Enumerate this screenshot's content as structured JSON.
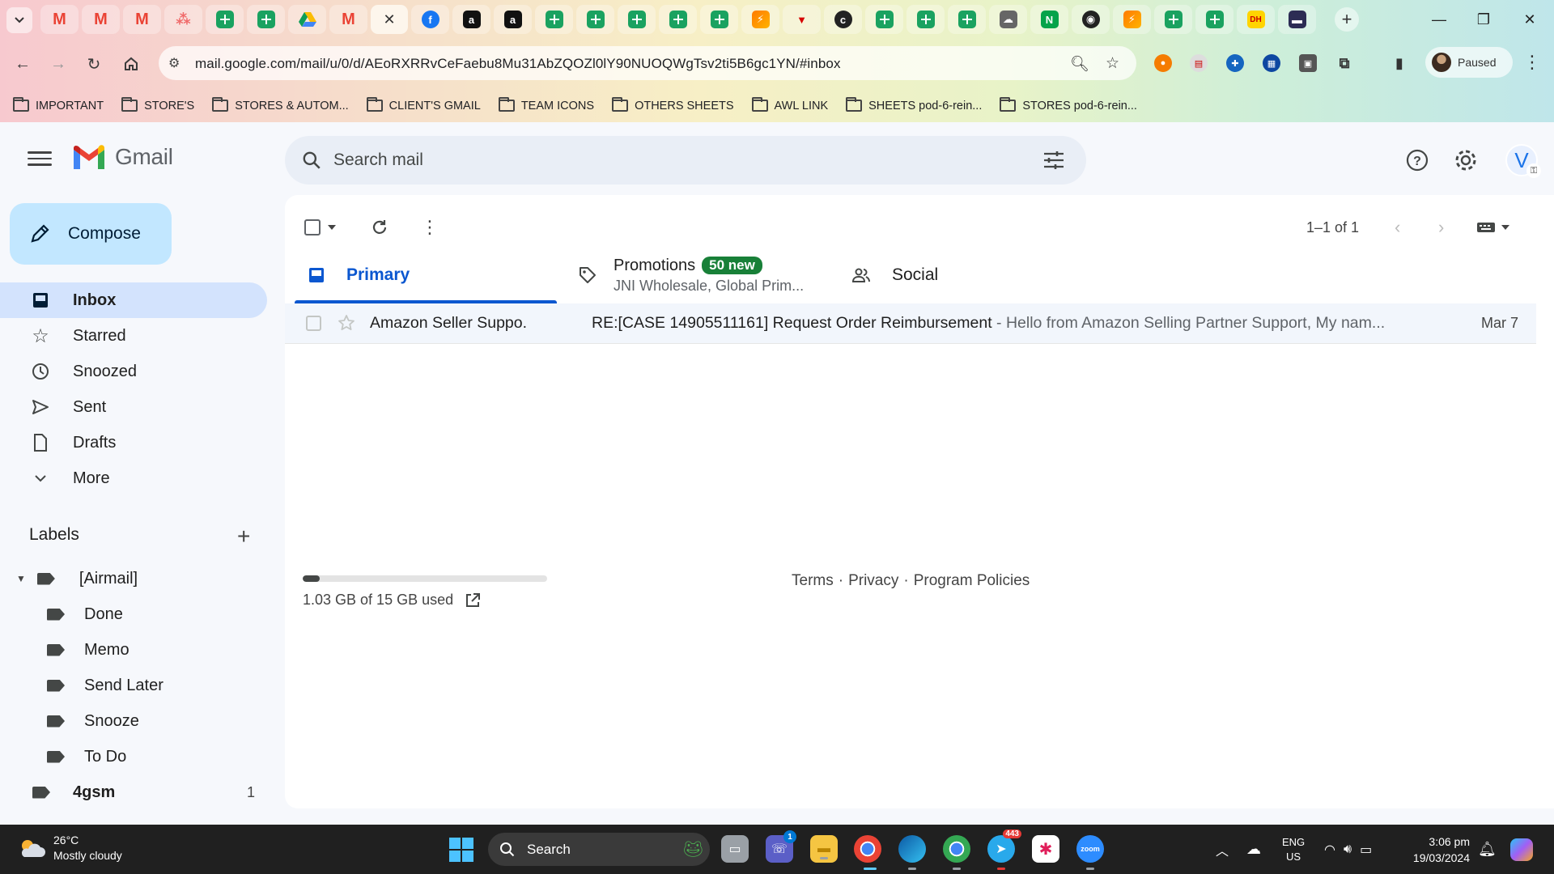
{
  "browser": {
    "url": "mail.google.com/mail/u/0/d/AEoRXRRvCeFaebu8Mu31AbZQOZl0lY90NUOQWgTsv2ti5B6gc1YN/#inbox",
    "profile_status": "Paused",
    "bookmarks": [
      "IMPORTANT",
      "STORE'S",
      "STORES & AUTOM...",
      "CLIENT'S GMAIL",
      "TEAM ICONS",
      "OTHERS SHEETS",
      "AWL LINK",
      "SHEETS pod-6-rein...",
      "STORES pod-6-rein..."
    ]
  },
  "gmail": {
    "app_name": "Gmail",
    "search_placeholder": "Search mail",
    "avatar_letter": "V",
    "compose_label": "Compose",
    "nav": [
      "Inbox",
      "Starred",
      "Snoozed",
      "Sent",
      "Drafts",
      "More"
    ],
    "labels_title": "Labels",
    "labels": [
      {
        "name": "[Airmail]",
        "count": ""
      },
      {
        "name": "Done",
        "count": ""
      },
      {
        "name": "Memo",
        "count": ""
      },
      {
        "name": "Send Later",
        "count": ""
      },
      {
        "name": "Snooze",
        "count": ""
      },
      {
        "name": "To Do",
        "count": ""
      },
      {
        "name": "4gsm",
        "count": "1"
      }
    ],
    "range_text": "1–1 of 1",
    "tabs": {
      "primary": "Primary",
      "promotions": "Promotions",
      "promotions_badge": "50 new",
      "promotions_sub": "JNI Wholesale, Global Prim...",
      "social": "Social"
    },
    "emails": [
      {
        "sender": "Amazon Seller Suppo.",
        "subject": "RE:[CASE 14905511161] Request Order Reimbursement",
        "snippet": " - Hello from Amazon Selling Partner Support, My nam...",
        "date": "Mar 7"
      }
    ],
    "storage": {
      "text": "1.03 GB of 15 GB used",
      "fraction": 0.069
    },
    "footer": {
      "terms": "Terms",
      "privacy": "Privacy",
      "policies": "Program Policies",
      "sep": "·"
    }
  },
  "taskbar": {
    "weather_temp": "26°C",
    "weather_desc": "Mostly cloudy",
    "search_label": "Search",
    "teams_badge": "1",
    "telegram_badge": "443",
    "lang_top": "ENG",
    "lang_bottom": "US",
    "time": "3:06 pm",
    "date": "19/03/2024"
  },
  "colors": {
    "accent": "#0b57d0",
    "compose": "#c2e7ff",
    "active_nav": "#d3e3fd",
    "badge": "#188038"
  }
}
